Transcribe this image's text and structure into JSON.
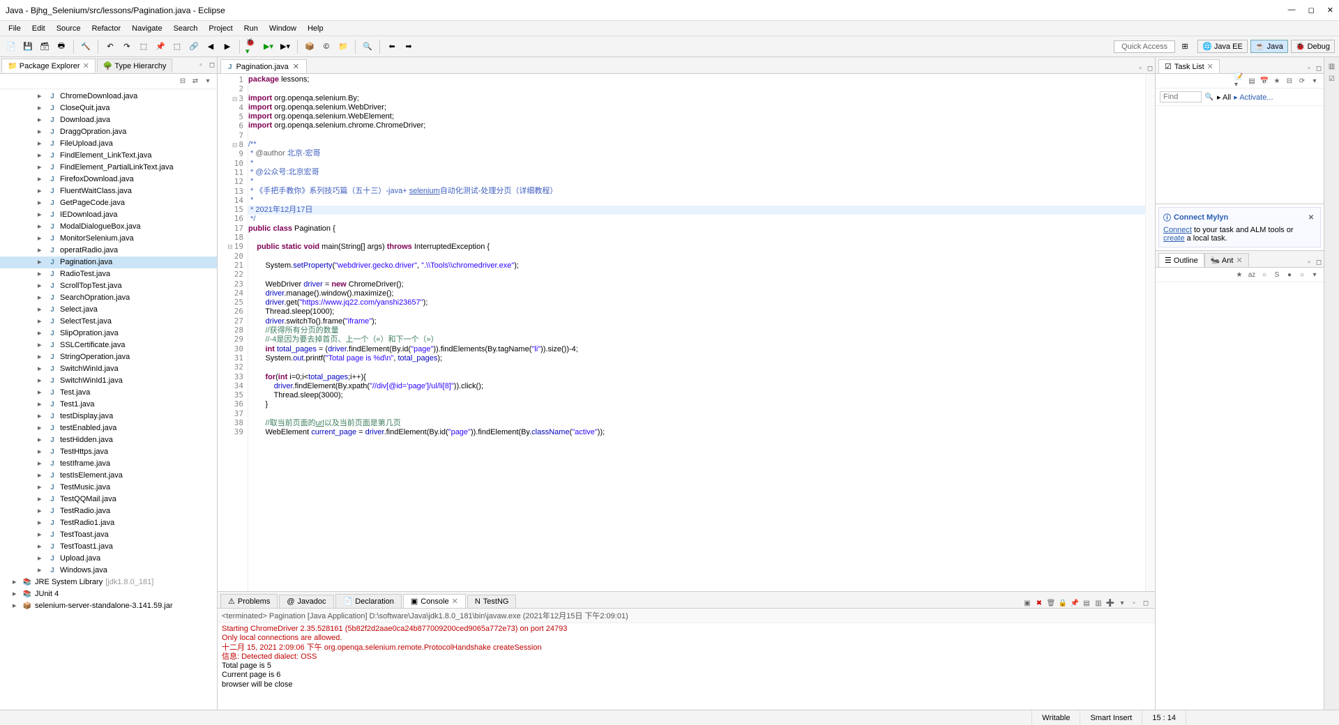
{
  "window": {
    "title": "Java - Bjhg_Selenium/src/lessons/Pagination.java - Eclipse"
  },
  "menus": [
    "File",
    "Edit",
    "Source",
    "Refactor",
    "Navigate",
    "Search",
    "Project",
    "Run",
    "Window",
    "Help"
  ],
  "quick_access": "Quick Access",
  "perspectives": [
    {
      "label": "Java EE",
      "icon": "🌐"
    },
    {
      "label": "Java",
      "icon": "☕",
      "active": true
    },
    {
      "label": "Debug",
      "icon": "🐞"
    }
  ],
  "left": {
    "tabs": [
      {
        "label": "Package Explorer",
        "icon": "📁",
        "active": true,
        "close": true
      },
      {
        "label": "Type Hierarchy",
        "icon": "🌳"
      }
    ],
    "files": [
      "ChromeDownload.java",
      "CloseQuit.java",
      "Download.java",
      "DraggOpration.java",
      "FileUpload.java",
      "FindElement_LinkText.java",
      "FindElement_PartialLinkText.java",
      "FirefoxDownload.java",
      "FluentWaitClass.java",
      "GetPageCode.java",
      "IEDownload.java",
      "ModalDialogueBox.java",
      "MonitorSelenium.java",
      "operatRadio.java",
      "Pagination.java",
      "RadioTest.java",
      "ScrollTopTest.java",
      "SearchOpration.java",
      "Select.java",
      "SelectTest.java",
      "SlipOpration.java",
      "SSLCertificate.java",
      "StringOperation.java",
      "SwitchWinId.java",
      "SwitchWinId1.java",
      "Test.java",
      "Test1.java",
      "testDisplay.java",
      "testEnabled.java",
      "testHidden.java",
      "TestHttps.java",
      "testIframe.java",
      "testIsElement.java",
      "TestMusic.java",
      "TestQQMail.java",
      "TestRadio.java",
      "TestRadio1.java",
      "TestToast.java",
      "TestToast1.java",
      "Upload.java",
      "Windows.java"
    ],
    "selected": "Pagination.java",
    "roots": [
      {
        "label": "JRE System Library",
        "suffix": "[jdk1.8.0_181]",
        "icon": "lib"
      },
      {
        "label": "JUnit 4",
        "icon": "lib"
      },
      {
        "label": "selenium-server-standalone-3.141.59.jar",
        "icon": "jar"
      }
    ]
  },
  "editor": {
    "tab_label": "Pagination.java",
    "lines_start": 1,
    "lines_end": 39,
    "code": [
      {
        "n": 1,
        "t": "plain",
        "s": "<span class='kw'>package</span> lessons;"
      },
      {
        "n": 2,
        "t": "plain",
        "s": ""
      },
      {
        "n": 3,
        "t": "fold",
        "s": "<span class='kw'>import</span> org.openqa.selenium.By;"
      },
      {
        "n": 4,
        "t": "plain",
        "s": "<span class='kw'>import</span> org.openqa.selenium.WebDriver;"
      },
      {
        "n": 5,
        "t": "plain",
        "s": "<span class='kw'>import</span> org.openqa.selenium.WebElement;"
      },
      {
        "n": 6,
        "t": "plain",
        "s": "<span class='kw'>import</span> org.openqa.selenium.chrome.ChromeDriver;"
      },
      {
        "n": 7,
        "t": "plain",
        "s": ""
      },
      {
        "n": 8,
        "t": "fold",
        "s": "<span class='doc'>/**</span>"
      },
      {
        "n": 9,
        "t": "plain",
        "s": "<span class='doc'> * <span class='ann'>@author</span> 北京-宏哥</span>"
      },
      {
        "n": 10,
        "t": "plain",
        "s": "<span class='doc'> *</span>"
      },
      {
        "n": 11,
        "t": "plain",
        "s": "<span class='doc'> * @公众号:北京宏哥</span>"
      },
      {
        "n": 12,
        "t": "plain",
        "s": "<span class='doc'> *</span>"
      },
      {
        "n": 13,
        "t": "plain",
        "s": "<span class='doc'> * 《手把手教你》系列技巧篇（五十三）-java+ <u>selenium</u>自动化测试-处理分页（详细教程）</span>"
      },
      {
        "n": 14,
        "t": "plain",
        "s": "<span class='doc'> *</span>"
      },
      {
        "n": 15,
        "t": "hl",
        "s": "<span class='doc'> * 2021年12月17日</span>"
      },
      {
        "n": 16,
        "t": "plain",
        "s": "<span class='doc'> */</span>"
      },
      {
        "n": 17,
        "t": "plain",
        "s": "<span class='kw'>public</span> <span class='kw'>class</span> Pagination {"
      },
      {
        "n": 18,
        "t": "plain",
        "s": ""
      },
      {
        "n": 19,
        "t": "fold",
        "s": "    <span class='kw'>public</span> <span class='kw'>static</span> <span class='kw'>void</span> main(String[] args) <span class='kw'>throws</span> InterruptedException {"
      },
      {
        "n": 20,
        "t": "plain",
        "s": ""
      },
      {
        "n": 21,
        "t": "plain",
        "s": "        System.<span class='fld'>setProperty</span>(<span class='str'>\"webdriver.gecko.driver\"</span>, <span class='str'>\".\\\\Tools\\\\chromedriver.exe\"</span>);"
      },
      {
        "n": 22,
        "t": "plain",
        "s": ""
      },
      {
        "n": 23,
        "t": "plain",
        "s": "        WebDriver <span class='fld'>driver</span> = <span class='kw'>new</span> ChromeDriver();"
      },
      {
        "n": 24,
        "t": "plain",
        "s": "        <span class='fld'>driver</span>.manage().window().maximize();"
      },
      {
        "n": 25,
        "t": "plain",
        "s": "        <span class='fld'>driver</span>.get(<span class='str'>\"https://www.jq22.com/yanshi23657\"</span>);"
      },
      {
        "n": 26,
        "t": "plain",
        "s": "        Thread.sleep(1000);"
      },
      {
        "n": 27,
        "t": "plain",
        "s": "        <span class='fld'>driver</span>.switchTo().frame(<span class='str'>\"iframe\"</span>);"
      },
      {
        "n": 28,
        "t": "plain",
        "s": "        <span class='cmt'>//获得所有分页的数量</span>"
      },
      {
        "n": 29,
        "t": "plain",
        "s": "        <span class='cmt'>//-4是因为要去掉首页、上一个（«）和下一个（»）</span>"
      },
      {
        "n": 30,
        "t": "plain",
        "s": "        <span class='kw'>int</span> <span class='fld'>total_pages</span> = (<span class='fld'>driver</span>.findElement(By.id(<span class='str'>\"page\"</span>)).findElements(By.tagName(<span class='str'>\"li\"</span>)).size())-4;"
      },
      {
        "n": 31,
        "t": "plain",
        "s": "        System.<span class='fld'>out</span>.printf(<span class='str'>\"Total page is %d\\n\"</span>, <span class='fld'>total_pages</span>);"
      },
      {
        "n": 32,
        "t": "plain",
        "s": ""
      },
      {
        "n": 33,
        "t": "plain",
        "s": "        <span class='kw'>for</span>(<span class='kw'>int</span> i=0;i&lt;<span class='fld'>total_pages</span>;i++){"
      },
      {
        "n": 34,
        "t": "plain",
        "s": "            <span class='fld'>driver</span>.findElement(By.xpath(<span class='str'>\"//div[@id='page']/ul/li[8]\"</span>)).click();"
      },
      {
        "n": 35,
        "t": "plain",
        "s": "            Thread.sleep(3000);"
      },
      {
        "n": 36,
        "t": "plain",
        "s": "        }"
      },
      {
        "n": 37,
        "t": "plain",
        "s": ""
      },
      {
        "n": 38,
        "t": "plain",
        "s": "        <span class='cmt'>//取当前页面的<u>url</u>以及当前页面是第几页</span>"
      },
      {
        "n": 39,
        "t": "plain",
        "s": "        WebElement <span class='fld'>current_page</span> = <span class='fld'>driver</span>.findElement(By.id(<span class='str'>\"page\"</span>)).findElement(By.<span class='fld'>className</span>(<span class='str'>\"active\"</span>));"
      }
    ]
  },
  "bottom": {
    "tabs": [
      {
        "label": "Problems",
        "icon": "⚠"
      },
      {
        "label": "Javadoc",
        "icon": "@"
      },
      {
        "label": "Declaration",
        "icon": "📄"
      },
      {
        "label": "Console",
        "icon": "▣",
        "active": true,
        "close": true
      },
      {
        "label": "TestNG",
        "icon": "N"
      }
    ],
    "description": "<terminated> Pagination [Java Application] D:\\software\\Java\\jdk1.8.0_181\\bin\\javaw.exe (2021年12月15日 下午2:09:01)",
    "output": [
      {
        "c": "red",
        "t": "Starting ChromeDriver 2.35.528161 (5b82f2d2aae0ca24b877009200ced9065a772e73) on port 24793"
      },
      {
        "c": "red",
        "t": "Only local connections are allowed."
      },
      {
        "c": "red",
        "t": "十二月 15, 2021 2:09:06 下午 org.openqa.selenium.remote.ProtocolHandshake createSession"
      },
      {
        "c": "red",
        "t": "信息: Detected dialect: OSS"
      },
      {
        "c": "",
        "t": "Total page is 5"
      },
      {
        "c": "",
        "t": "Current page is 6"
      },
      {
        "c": "",
        "t": "browser will be close"
      }
    ]
  },
  "right": {
    "task_tab": "Task List",
    "find_placeholder": "Find",
    "find_all": "All",
    "find_activate": "Activate...",
    "mylyn_title": "Connect Mylyn",
    "mylyn_connect": "Connect",
    "mylyn_text1": " to your task and ALM tools or ",
    "mylyn_create": "create",
    "mylyn_text2": " a local task.",
    "outline_tabs": [
      {
        "label": "Outline",
        "icon": "☰",
        "active": true
      },
      {
        "label": "Ant",
        "icon": "🐜",
        "close": true
      }
    ]
  },
  "status": {
    "writable": "Writable",
    "insert": "Smart Insert",
    "pos": "15 : 14"
  }
}
